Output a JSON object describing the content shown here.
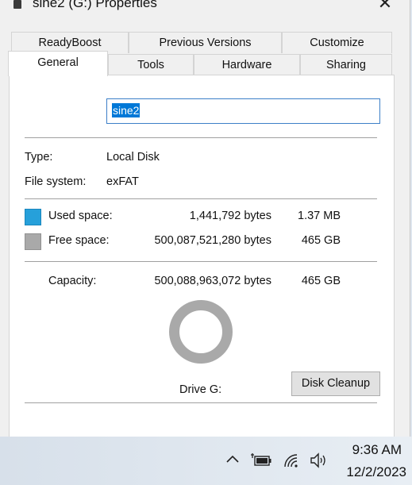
{
  "window": {
    "title": "sine2 (G:) Properties",
    "close_glyph": "✕"
  },
  "tabs": {
    "row1": [
      "ReadyBoost",
      "Previous Versions",
      "Customize"
    ],
    "row2": [
      "General",
      "Tools",
      "Hardware",
      "Sharing"
    ],
    "active": "General"
  },
  "general": {
    "volume_name": "sine2",
    "type_label": "Type:",
    "type_value": "Local Disk",
    "fs_label": "File system:",
    "fs_value": "exFAT",
    "used_label": "Used space:",
    "used_bytes": "1,441,792 bytes",
    "used_short": "1.37 MB",
    "free_label": "Free space:",
    "free_bytes": "500,087,521,280 bytes",
    "free_short": "465 GB",
    "capacity_label": "Capacity:",
    "capacity_bytes": "500,088,963,072 bytes",
    "capacity_short": "465 GB",
    "drive_label": "Drive G:",
    "cleanup_button": "Disk Cleanup",
    "used_color": "#26a0da",
    "free_color": "#a9a9a9",
    "used_fraction": 2.9e-06
  },
  "taskbar": {
    "time": "9:36 AM",
    "date": "12/2/2023",
    "icons": [
      "chevron-up-icon",
      "battery-plug-icon",
      "wifi-icon",
      "speaker-icon"
    ]
  }
}
